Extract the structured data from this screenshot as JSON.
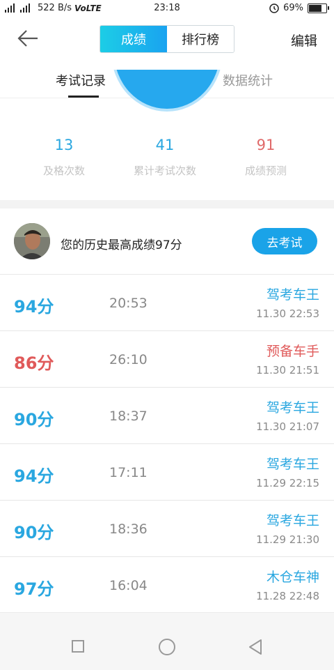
{
  "status_bar": {
    "network": "522 B/s",
    "volte": "VoLTE",
    "time": "23:18",
    "battery": "69%",
    "battery_level": 0.69
  },
  "header": {
    "segment_active": "成绩",
    "segment_inactive": "排行榜",
    "edit_label": "编辑"
  },
  "tabs": {
    "records": "考试记录",
    "stats": "数据统计"
  },
  "stats": [
    {
      "value": "13",
      "label": "及格次数",
      "color": "#2aa7e0"
    },
    {
      "value": "41",
      "label": "累计考试次数",
      "color": "#2aa7e0"
    },
    {
      "value": "91",
      "label": "成绩预测",
      "color": "#e06a6a"
    }
  ],
  "best": {
    "text": "您的历史最高成绩97分",
    "button": "去考试"
  },
  "records": [
    {
      "score": "94分",
      "duration": "20:53",
      "rank": "驾考车王",
      "date": "11.30  22:53",
      "color": "#2aa7e0"
    },
    {
      "score": "86分",
      "duration": "26:10",
      "rank": "预备车手",
      "date": "11.30  21:51",
      "color": "#e05a5a"
    },
    {
      "score": "90分",
      "duration": "18:37",
      "rank": "驾考车王",
      "date": "11.30  21:07",
      "color": "#2aa7e0"
    },
    {
      "score": "94分",
      "duration": "17:11",
      "rank": "驾考车王",
      "date": "11.29  22:15",
      "color": "#2aa7e0"
    },
    {
      "score": "90分",
      "duration": "18:36",
      "rank": "驾考车王",
      "date": "11.29  21:30",
      "color": "#2aa7e0"
    },
    {
      "score": "97分",
      "duration": "16:04",
      "rank": "木仓车神",
      "date": "11.28  22:48",
      "color": "#2aa7e0"
    }
  ],
  "icons": {
    "back": "arrow-left-icon",
    "nav_recent": "square-icon",
    "nav_home": "circle-icon",
    "nav_back": "triangle-back-icon"
  }
}
